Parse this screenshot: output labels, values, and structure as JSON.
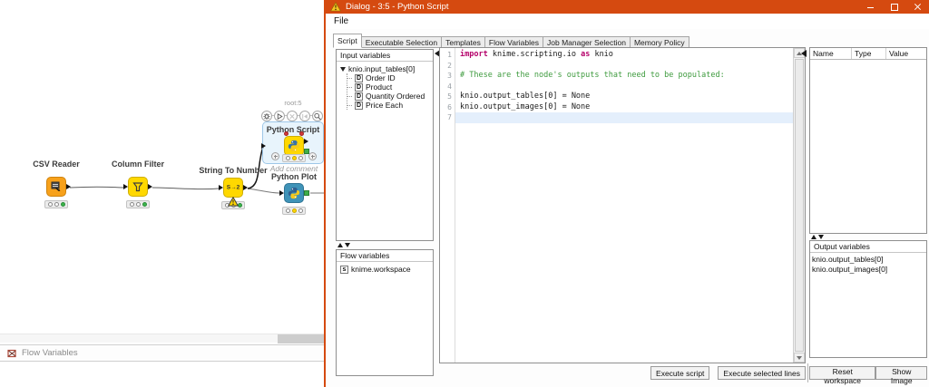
{
  "colors": {
    "titlebar_orange": "#d54a10",
    "keyword_magenta": "#b5006a",
    "comment_green": "#3f9b3f",
    "current_line_blue": "#e4effc",
    "reader_orange": "#f7a11b",
    "manipulator_yellow": "#ffd800",
    "visualizer_blue": "#3f93b8",
    "status_green": "#3cb64c",
    "status_yellow": "#ffd500",
    "image_port_green": "#3fae49",
    "flowvar_port_red": "#d23939",
    "selection_blue": "#9ec7e8"
  },
  "workflow": {
    "bottom_bar": {
      "flow_variables_label": "Flow Variables"
    },
    "nodes": {
      "csv_reader": {
        "label": "CSV Reader"
      },
      "column_filter": {
        "label": "Column Filter"
      },
      "string_to_number": {
        "label": "String To Number",
        "icon_text": "S→2"
      },
      "python_script": {
        "label": "Python Script",
        "annotation": "root:5"
      },
      "python_plot": {
        "label": "Python Plot",
        "comment": "Add comment"
      }
    }
  },
  "dialog": {
    "title": "Dialog - 3:5 - Python Script",
    "menu": [
      "File"
    ],
    "tabs": [
      "Script",
      "Executable Selection",
      "Templates",
      "Flow Variables",
      "Job Manager Selection",
      "Memory Policy"
    ],
    "active_tab": "Script",
    "input_variables": {
      "title": "Input variables",
      "root": "knio.input_tables[0]",
      "type_icon": "D",
      "items": [
        "Order ID",
        "Product",
        "Quantity Ordered",
        "Price Each"
      ]
    },
    "flow_variables": {
      "title": "Flow variables",
      "type_icon": "s",
      "items": [
        "knime.workspace"
      ]
    },
    "editor": {
      "line_numbers": [
        "1",
        "2",
        "3",
        "4",
        "5",
        "6",
        "7"
      ],
      "line1": [
        "import",
        " knime.scripting.io ",
        "as",
        " knio"
      ],
      "line3": "# These are the node's outputs that need to be populated:",
      "line5": "knio.output_tables[0] = None",
      "line6": "knio.output_images[0] = None"
    },
    "variables_table": {
      "columns": [
        "Name",
        "Type",
        "Value"
      ]
    },
    "output_variables": {
      "title": "Output variables",
      "items": [
        "knio.output_tables[0]",
        "knio.output_images[0]"
      ]
    },
    "buttons": {
      "execute_script": "Execute script",
      "execute_selected": "Execute selected lines",
      "reset_workspace": "Reset workspace",
      "show_image": "Show Image"
    }
  }
}
